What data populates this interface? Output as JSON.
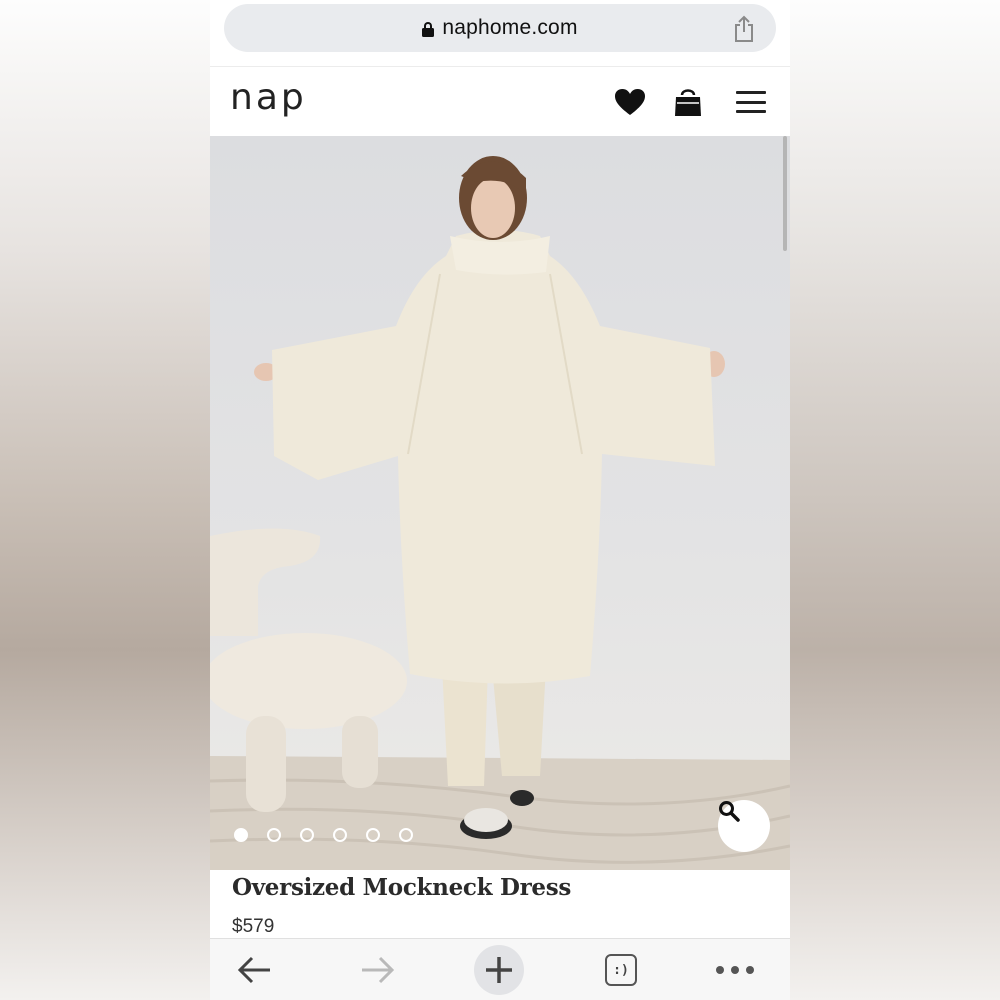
{
  "browser": {
    "url": "naphome.com",
    "icons": {
      "lock": "lock-icon",
      "share": "share-icon"
    }
  },
  "site": {
    "logo": "nap",
    "icons": {
      "wishlist": "heart-icon",
      "cart": "shopping-bag-icon",
      "menu": "hamburger-menu-icon"
    }
  },
  "gallery": {
    "image_count": 6,
    "active_index": 0,
    "zoom_icon": "magnifier-icon"
  },
  "product": {
    "title": "Oversized Mockneck Dress",
    "price": "$579"
  },
  "toolbar": {
    "tabs_label": ":)",
    "icons": [
      "back-arrow-icon",
      "forward-arrow-icon",
      "plus-icon",
      "tabs-icon",
      "more-dots-icon"
    ]
  },
  "colors": {
    "accent": "#111111",
    "url_bar_bg": "#e9ebee",
    "garment": "#efe9da"
  }
}
